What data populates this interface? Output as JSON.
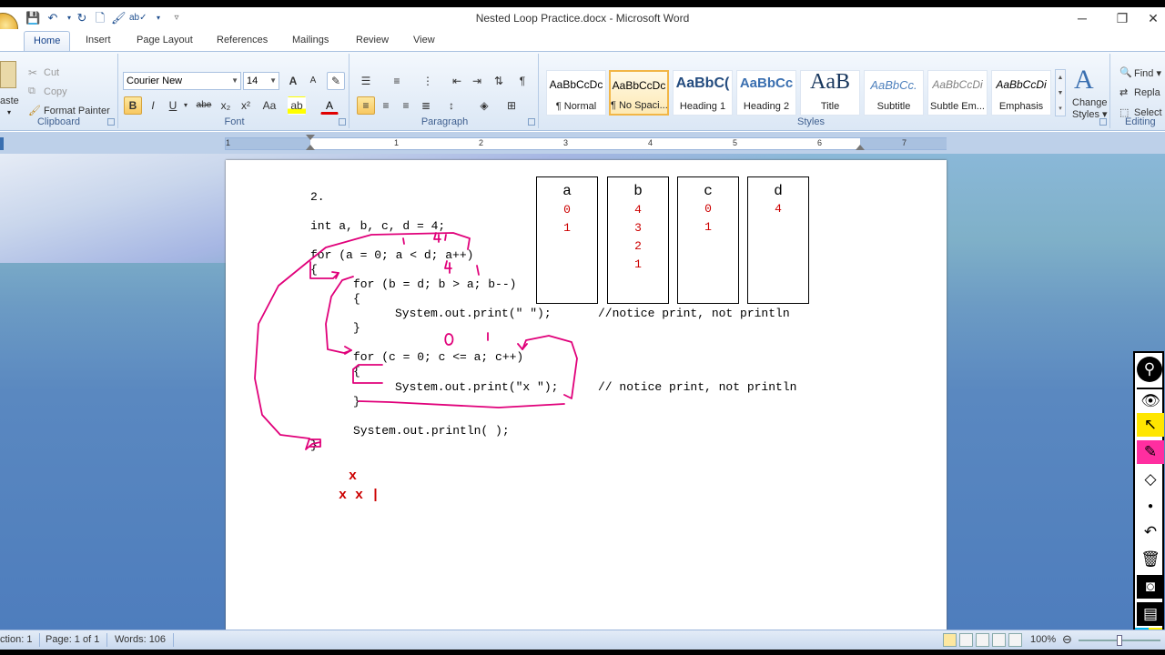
{
  "window": {
    "title": "Nested Loop Practice.docx - Microsoft Word",
    "minimize": "─",
    "restore": "❐",
    "close": "✕"
  },
  "tabs": [
    "Home",
    "Insert",
    "Page Layout",
    "References",
    "Mailings",
    "Review",
    "View"
  ],
  "ribbon": {
    "clipboard": {
      "paste": "aste",
      "cut": "Cut",
      "copy": "Copy",
      "format_painter": "Format Painter",
      "label": "Clipboard"
    },
    "font": {
      "name": "Courier New",
      "size": "14",
      "label": "Font",
      "bold": "B",
      "italic": "I",
      "underline": "U",
      "strike": "abe",
      "subscript": "x₂",
      "superscript": "x²",
      "change_case": "Aa",
      "grow": "A",
      "shrink": "A",
      "font_color": "A"
    },
    "paragraph": {
      "label": "Paragraph",
      "pilcrow": "¶"
    },
    "styles": {
      "label": "Styles",
      "items": [
        {
          "sample": "AaBbCcDc",
          "name": "¶ Normal"
        },
        {
          "sample": "AaBbCcDc",
          "name": "¶ No Spaci..."
        },
        {
          "sample": "AaBbC(",
          "name": "Heading 1"
        },
        {
          "sample": "AaBbCc",
          "name": "Heading 2"
        },
        {
          "sample": "AaB",
          "name": "Title"
        },
        {
          "sample": "AaBbCc.",
          "name": "Subtitle"
        },
        {
          "sample": "AaBbCcDi",
          "name": "Subtle Em..."
        },
        {
          "sample": "AaBbCcDi",
          "name": "Emphasis"
        }
      ],
      "change_styles": [
        "Change",
        "Styles ▾"
      ]
    },
    "editing": {
      "find": "Find ▾",
      "replace": "Repla",
      "select": "Select",
      "label": "Editing"
    }
  },
  "ruler": {
    "numbers": [
      "1",
      "1",
      "2",
      "3",
      "4",
      "5",
      "6",
      "7"
    ]
  },
  "document": {
    "lines": [
      "2.",
      "int a, b, c, d = 4;",
      "for (a = 0; a < d; a++)",
      "{",
      "for (b = d; b > a; b--)",
      "{",
      "System.out.print(\" \");",
      "//notice print, not println",
      "}",
      "for (c = 0; c <= a; c++)",
      "{",
      "System.out.print(\"x \");",
      "// notice print, not println",
      "}",
      "System.out.println( );",
      "}"
    ],
    "trace_table": [
      {
        "header": "a",
        "values": [
          "0",
          "1"
        ]
      },
      {
        "header": "b",
        "values": [
          "4",
          "3",
          "2",
          "1"
        ]
      },
      {
        "header": "c",
        "values": [
          "0",
          "1"
        ]
      },
      {
        "header": "d",
        "values": [
          "4"
        ]
      }
    ],
    "output": [
      "x",
      "x x |"
    ],
    "ink_annotations": [
      "4",
      "4",
      "0",
      "1"
    ]
  },
  "status": {
    "section": "ction: 1",
    "page": "Page: 1 of 1",
    "words": "Words: 106",
    "zoom": "100%",
    "zoom_level": 1.0
  },
  "colors": {
    "ink": "#e0007a",
    "trace_values": "#cc0000",
    "ribbon_accent": "#15428b"
  },
  "ink_toolbar": [
    "pin-icon",
    "eye-icon",
    "pointer-icon",
    "highlighter-icon",
    "eraser-icon",
    "dot-icon",
    "undo-icon",
    "trash-icon",
    "camera-icon",
    "page-icon",
    "color-palette-icon"
  ]
}
